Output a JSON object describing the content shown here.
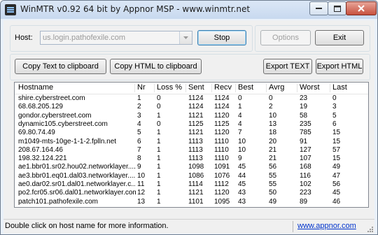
{
  "window": {
    "title": "WinMTR v0.92 64 bit by Appnor MSP - www.winmtr.net"
  },
  "host": {
    "label": "Host:",
    "value": "us.login.pathofexile.com"
  },
  "buttons": {
    "stop": "Stop",
    "options": "Options",
    "exit": "Exit",
    "copy_text": "Copy Text to clipboard",
    "copy_html": "Copy HTML to clipboard",
    "export_text": "Export TEXT",
    "export_html": "Export HTML"
  },
  "table": {
    "columns": [
      "Hostname",
      "Nr",
      "Loss %",
      "Sent",
      "Recv",
      "Best",
      "Avrg",
      "Worst",
      "Last"
    ],
    "rows": [
      [
        "shire.cyberstreet.com",
        "1",
        "0",
        "1124",
        "1124",
        "0",
        "0",
        "23",
        "0"
      ],
      [
        "68.68.205.129",
        "2",
        "0",
        "1124",
        "1124",
        "1",
        "2",
        "19",
        "3"
      ],
      [
        "gondor.cyberstreet.com",
        "3",
        "1",
        "1121",
        "1120",
        "4",
        "10",
        "58",
        "5"
      ],
      [
        "dynamic105.cyberstreet.com",
        "4",
        "0",
        "1125",
        "1125",
        "4",
        "13",
        "235",
        "6"
      ],
      [
        "69.80.74.49",
        "5",
        "1",
        "1121",
        "1120",
        "7",
        "18",
        "785",
        "15"
      ],
      [
        "m1049-mts-10ge-1-1-2.fplln.net",
        "6",
        "1",
        "1113",
        "1110",
        "10",
        "20",
        "91",
        "15"
      ],
      [
        "208.67.164.46",
        "7",
        "1",
        "1113",
        "1110",
        "10",
        "21",
        "127",
        "57"
      ],
      [
        "198.32.124.221",
        "8",
        "1",
        "1113",
        "1110",
        "9",
        "21",
        "107",
        "15"
      ],
      [
        "ae1.bbr01.sr02.hou02.networklayer....",
        "9",
        "1",
        "1098",
        "1091",
        "45",
        "56",
        "168",
        "49"
      ],
      [
        "ae3.bbr01.eq01.dal03.networklayer....",
        "10",
        "1",
        "1086",
        "1076",
        "44",
        "55",
        "116",
        "47"
      ],
      [
        "ae0.dar02.sr01.dal01.networklayer.c...",
        "11",
        "1",
        "1114",
        "1112",
        "45",
        "55",
        "102",
        "56"
      ],
      [
        "po2.fcr05.sr06.dal01.networklayer.com",
        "12",
        "1",
        "1121",
        "1120",
        "43",
        "50",
        "223",
        "45"
      ],
      [
        "patch101.pathofexile.com",
        "13",
        "1",
        "1101",
        "1095",
        "43",
        "49",
        "89",
        "46"
      ]
    ]
  },
  "status": {
    "message": "Double click on host name for more information.",
    "link": "www.appnor.com"
  }
}
